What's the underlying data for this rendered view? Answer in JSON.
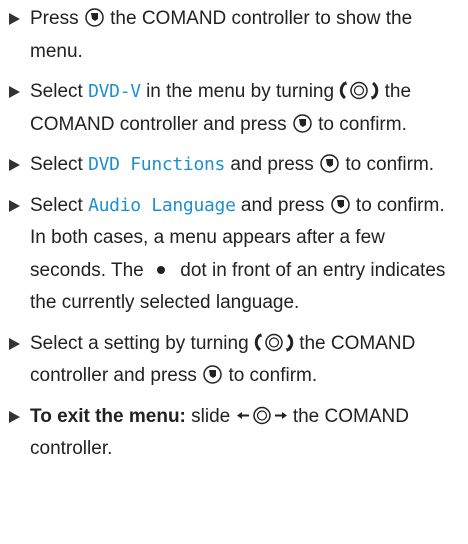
{
  "steps": [
    {
      "t1": "Press",
      "t2": "the COMAND controller to show the menu."
    },
    {
      "t1": "Select",
      "menu": "DVD-V",
      "t2": "in the menu by turning",
      "t3": "the COMAND controller and press",
      "t4": "to confirm."
    },
    {
      "t1": "Select",
      "menu": "DVD Functions",
      "t2": "and press",
      "t3": "to confirm."
    },
    {
      "t1": "Select",
      "menu": "Audio Language",
      "t2": "and press",
      "t3": "to confirm.",
      "note1": "In both cases, a menu appears after a few seconds. The",
      "note2": "dot in front of an entry indicates the currently selected language."
    },
    {
      "t1": "Select a setting by turning",
      "t2": "the COMAND controller and press",
      "t3": "to confirm."
    },
    {
      "bold": "To exit the menu:",
      "t1": "slide",
      "t2": "the COMAND controller."
    }
  ],
  "icons": {
    "press": "press-controller-icon",
    "turn": "turn-controller-icon",
    "slide": "slide-controller-icon",
    "bullet": "filled-dot-icon",
    "arrow": "step-arrow-icon"
  }
}
